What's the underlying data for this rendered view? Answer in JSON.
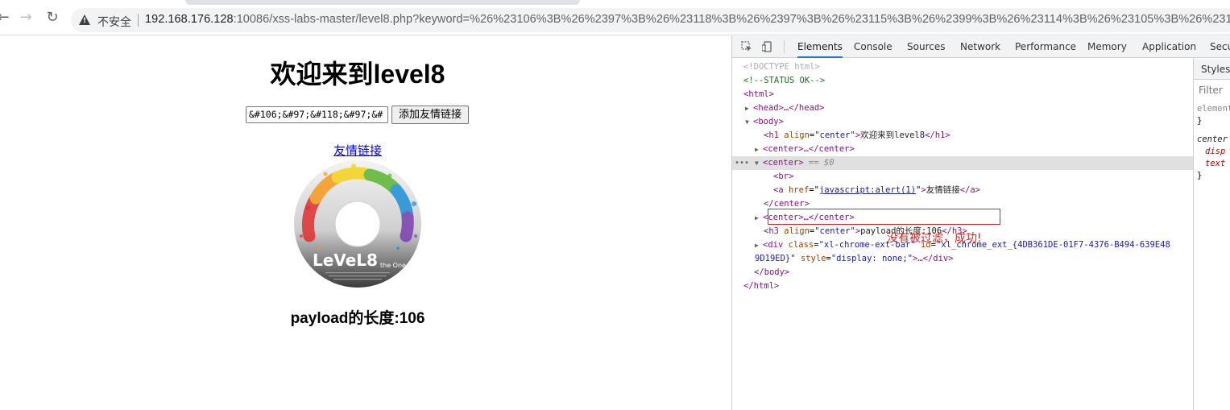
{
  "browser": {
    "security_label": "不安全",
    "url_host": "192.168.176.128",
    "url_rest": ":10086/xss-labs-master/level8.php?keyword=%26%23106%3B%26%2397%3B%26%23118%3B%26%2397%3B%26%23115%3B%26%2399%3B%26%23114%3B%26%23105%3B%26%231"
  },
  "page": {
    "title": "欢迎来到level8",
    "keyword_value": "&#106;&#97;&#118;&#97;&#",
    "submit_label": "添加友情链接",
    "friend_link": "友情链接",
    "payload_length": "payload的长度:106"
  },
  "devtools": {
    "tabs": [
      "Elements",
      "Console",
      "Sources",
      "Network",
      "Performance",
      "Memory",
      "Application",
      "Secu"
    ],
    "active_tab": "Elements",
    "dom": {
      "doctype": "<!DOCTYPE html>",
      "comment": "<!--STATUS OK-->",
      "html_open": "<html>",
      "head": "<head>…</head>",
      "body_open": "<body>",
      "h1_open": "<h1",
      "h1_attr": "align",
      "h1_val": "\"center\"",
      "h1_text": "欢迎来到level8",
      "h1_close": "</h1>",
      "center_collapsed": "<center>…</center>",
      "center_open": "<center>",
      "selected_suffix": "== $0",
      "br": "<br>",
      "a_open": "<a",
      "a_attr": "href",
      "a_href": "javascript:alert(1)",
      "a_text": "友情链接",
      "a_close": "</a>",
      "center_close": "</center>",
      "center_collapsed_2": "<center>…</center>",
      "h3_open": "<h3",
      "h3_attr": "align",
      "h3_val": "\"center\"",
      "h3_text": "payload的长度:106",
      "h3_close": "</h3>",
      "div_open": "<div",
      "div_class_attr": "class",
      "div_class_val": "\"xl-chrome-ext-bar\"",
      "div_id_attr": "id",
      "div_id_val": "\"xl_chrome_ext_{4DB361DE-01F7-4376-B494-639E48",
      "div_id_val_cont": "9D19ED}\"",
      "div_style_attr": "style",
      "div_style_val": "\"display: none;\"",
      "div_rest": ">…</div>",
      "body_close": "</body>",
      "html_close": "</html>"
    },
    "annotation": "没有被过滤，成功!",
    "styles": {
      "tab_label": "Styles",
      "filter_placeholder": "Filter",
      "rule1_selector": "element",
      "rule1_close": "}",
      "rule2_selector": "center",
      "rule2_prop1": "disp",
      "rule2_prop2": "text",
      "rule2_close": "}"
    }
  }
}
